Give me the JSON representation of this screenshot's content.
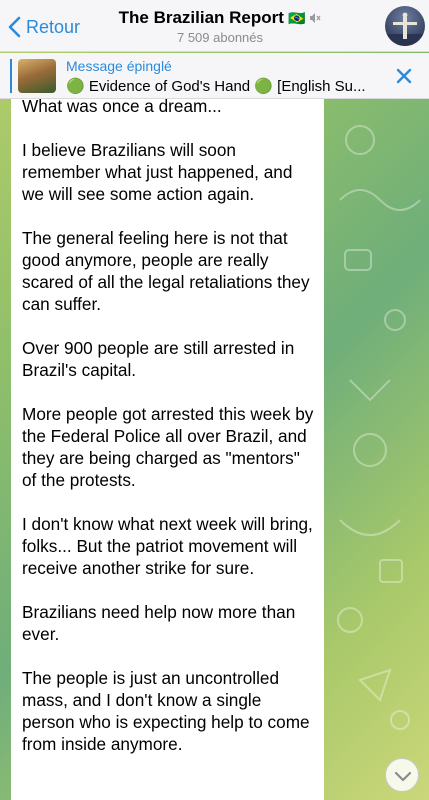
{
  "header": {
    "back_label": "Retour",
    "channel_title": "The Brazilian Report",
    "flag_emoji": "🇧🇷",
    "muted_icon": "mute-icon",
    "subscribers": "7 509 abonnés",
    "avatar_icon": "christ-statue-avatar"
  },
  "pinned": {
    "label": "Message épinglé",
    "text": "🟢 Evidence of God's Hand 🟢 [English Su...",
    "close_icon": "close-icon"
  },
  "message": {
    "text": "What was once a dream...\n\nI believe Brazilians will soon remember what just happened, and we will see some action again.\n\nThe general feeling here is not that good anymore, people are really scared of all the legal retaliations they can suffer.\n\nOver 900 people are still arrested in Brazil's capital.\n\nMore people got arrested this week by the Federal Police all over Brazil, and they are being charged as \"mentors\" of the protests.\n\nI don't know what next week will bring, folks... But the patriot movement will receive another strike for sure.\n\nBrazilians need help now more than ever.\n\nThe people is just an uncontrolled mass, and I don't know a single person who is expecting help to come from inside anymore."
  },
  "scroll_button_icon": "chevron-down-icon",
  "colors": {
    "accent": "#2a8bdc",
    "header_bg": "#f6f6f8",
    "bubble_bg": "#ffffff"
  }
}
